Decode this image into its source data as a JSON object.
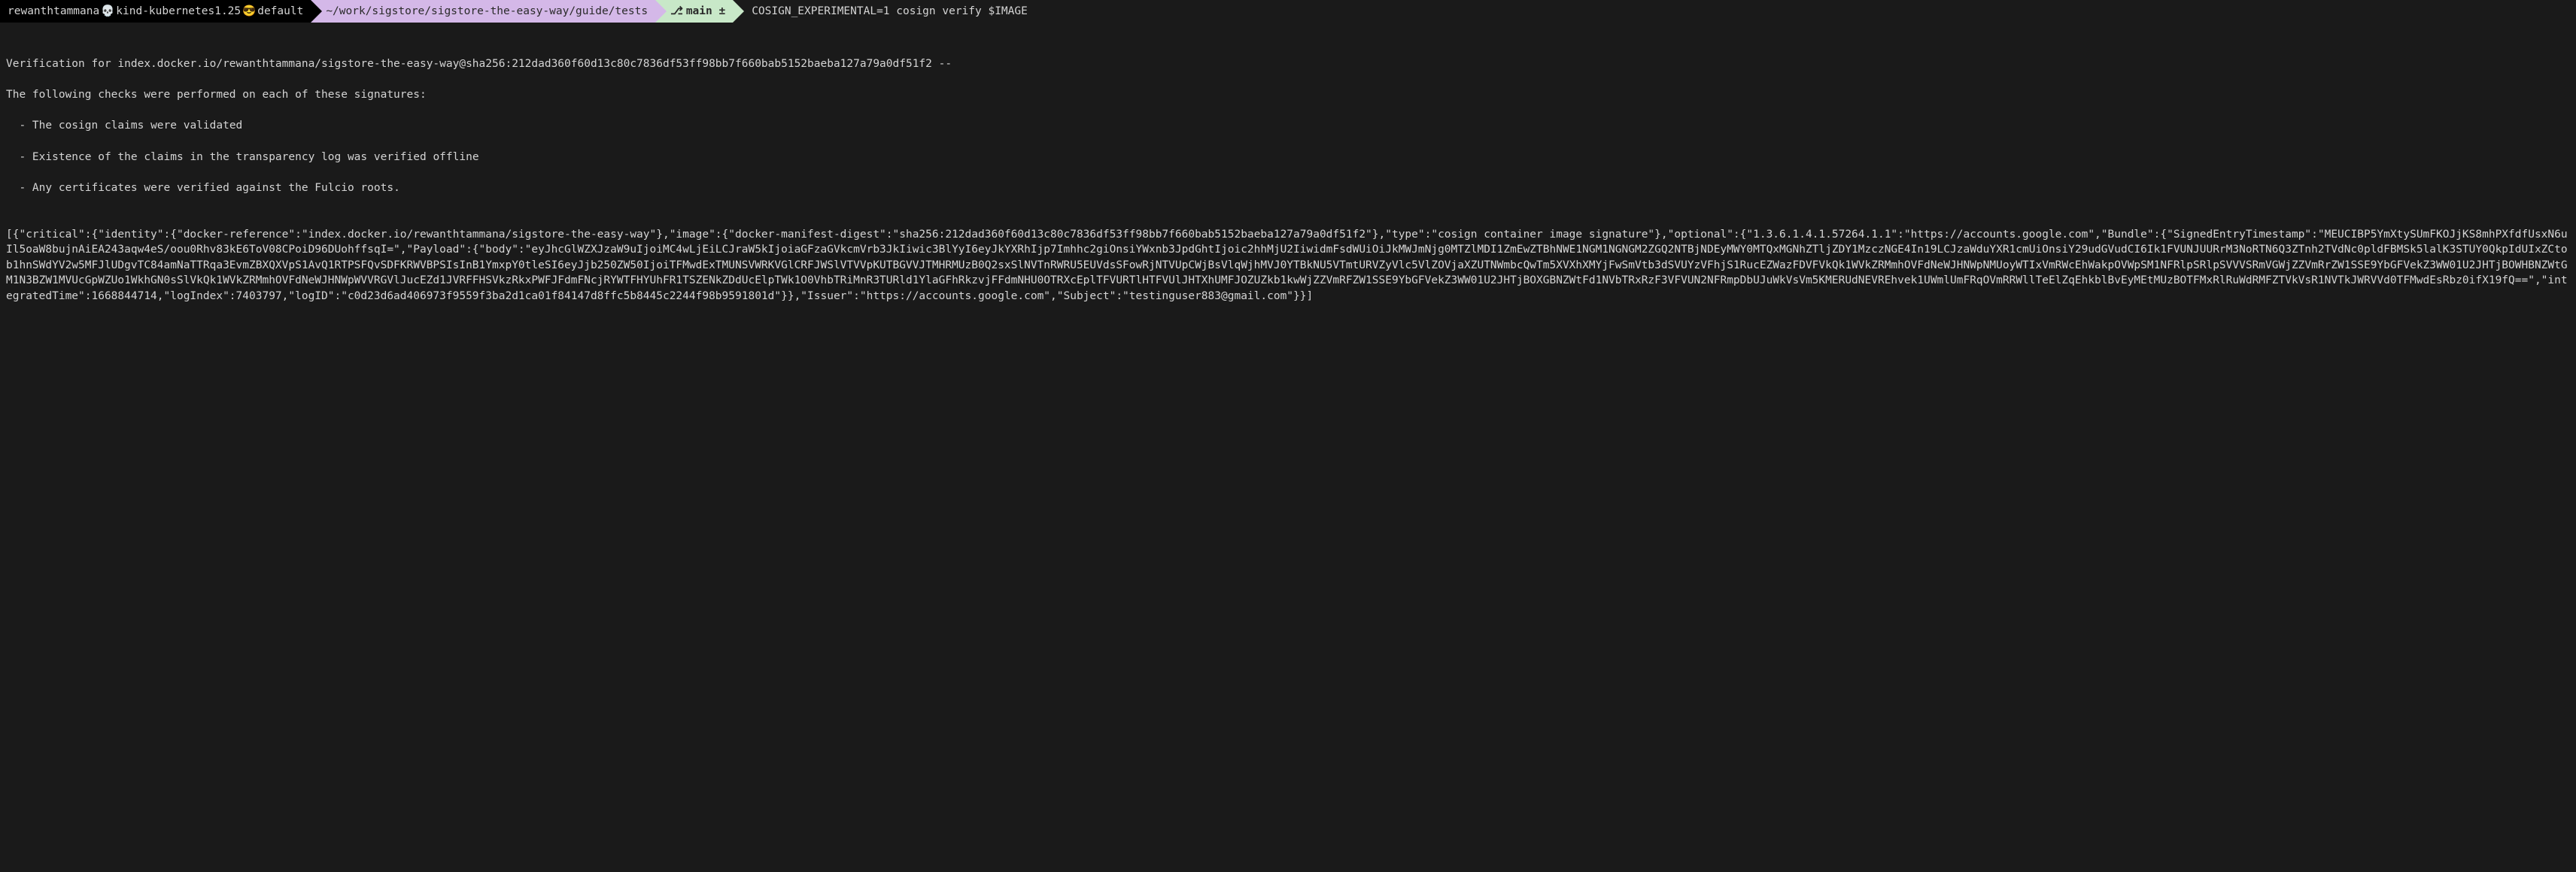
{
  "prompt": {
    "host_prefix": "rewanthtammana",
    "skull": "💀",
    "host_mid": "kind-kubernetes1.25",
    "smiley": "😎",
    "host_suffix": "default",
    "path": "~/work/sigstore/sigstore-the-easy-way/guide/tests",
    "branch_icon": "⎇",
    "branch": "main ±",
    "command": "COSIGN_EXPERIMENTAL=1 cosign verify $IMAGE"
  },
  "output": {
    "blank1": "",
    "line1": "Verification for index.docker.io/rewanthtammana/sigstore-the-easy-way@sha256:212dad360f60d13c80c7836df53ff98bb7f660bab5152baeba127a79a0df51f2 --",
    "line2": "The following checks were performed on each of these signatures:",
    "line3": "  - The cosign claims were validated",
    "line4": "  - Existence of the claims in the transparency log was verified offline",
    "line5": "  - Any certificates were verified against the Fulcio roots.",
    "blank2": "",
    "json": "[{\"critical\":{\"identity\":{\"docker-reference\":\"index.docker.io/rewanthtammana/sigstore-the-easy-way\"},\"image\":{\"docker-manifest-digest\":\"sha256:212dad360f60d13c80c7836df53ff98bb7f660bab5152baeba127a79a0df51f2\"},\"type\":\"cosign container image signature\"},\"optional\":{\"1.3.6.1.4.1.57264.1.1\":\"https://accounts.google.com\",\"Bundle\":{\"SignedEntryTimestamp\":\"MEUCIBP5YmXtySUmFKOJjKS8mhPXfdfUsxN6uIl5oaW8bujnAiEA243aqw4eS/oou0Rhv83kE6ToV08CPoiD96DUohffsqI=\",\"Payload\":{\"body\":\"eyJhcGlWZXJzaW9uIjoiMC4wLjEiLCJraW5kIjoiaGFzaGVkcmVrb3JkIiwic3BlYyI6eyJkYXRhIjp7Imhhc2giOnsiYWxnb3JpdGhtIjoic2hhMjU2IiwidmFsdWUiOiJkMWJmNjg0MTZlMDI1ZmEwZTBhNWE1NGM1NGNGM2ZGQ2NTBjNDEyMWY0MTQxMGNhZTljZDY1MzczNGE4In19LCJzaWduYXR1cmUiOnsiY29udGVudCI6Ik1FVUNJUURrM3NoRTN6Q3ZTnh2TVdNc0pldFBMSk5lalK3STUY0QkpIdUIxZCtob1hnSWdYV2w5MFJlUDgvTC84amNaTTRqa3EvmZBXQXVpS1AvQ1RTPSFQvSDFKRWVBPSIsInB1YmxpY0tleSI6eyJjb250ZW50IjoiTFMwdExTMUNSVWRKVGlCRFJWSlVTVVpKUTBGVVJTMHRMUzB0Q2sxSlNVTnRWRU5EUVdsSFowRjNTVUpCWjBsVlqWjhMVJ0YTBkNU5VTmtURVZyVlc5VlZOVjaXZUTNWmbcQwTm5XVXhXMYjFwSmVtb3dSVUYzVFhjS1RucEZWazFDVFVkQk1WVkZRMmhOVFdNeWJHNWpNMUoyWTIxVmRWcEhWakpOVWpSM1NFRlpSRlpSVVVSRmVGWjZZVmRrZW1SSE9YbGFVekZ3WW01U2JHTjBOWHBNZWtGM1N3BZW1MVUcGpWZUo1WkhGN0sSlVkQk1WVkZRMmhOVFdNeWJHNWpWVVRGVlJucEZd1JVRFFHSVkzRkxPWFJFdmFNcjRYWTFHYUhFR1TSZENkZDdUcElpTWk1O0VhbTRiMnR3TURld1YlaGFhRkzvjFFdmNHU0OTRXcEplTFVURTlHTFVUlJHTXhUMFJOZUZkb1kwWjZZVmRFZW1SSE9YbGFVekZ3WW01U2JHTjBOXGBNZWtFd1NVbTRxRzF3VFVUN2NFRmpDbUJuWkVsVm5KMERUdNEVREhvek1UWmlUmFRqOVmRRWllTeElZqEhkblBvEyMEtMUzBOTFMxRlRuWdRMFZTVkVsR1NVTkJWRVVd0TFMwdEsRbz0ifX19fQ==\",\"integratedTime\":1668844714,\"logIndex\":7403797,\"logID\":\"c0d23d6ad406973f9559f3ba2d1ca01f84147d8ffc5b8445c2244f98b9591801d\"}},\"Issuer\":\"https://accounts.google.com\",\"Subject\":\"testinguser883@gmail.com\"}}]"
  }
}
